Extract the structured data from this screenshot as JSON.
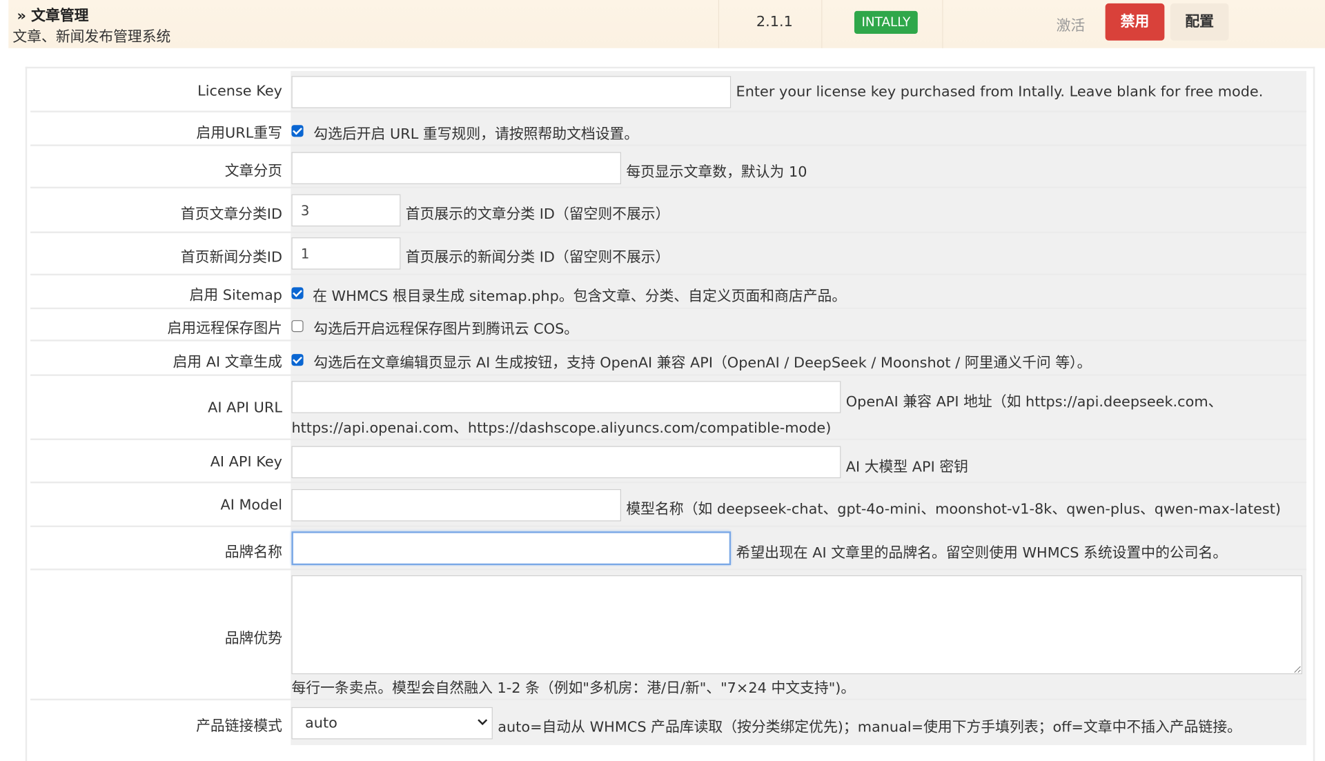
{
  "module": {
    "title": "» 文章管理",
    "subtitle": "文章、新闻发布管理系统",
    "version": "2.1.1",
    "badge": "INTALLY",
    "activate": "激活",
    "disable": "禁用",
    "config": "配置"
  },
  "settings": {
    "license_key": {
      "label": "License Key",
      "value": "",
      "desc": "Enter your license key purchased from Intally. Leave blank for free mode."
    },
    "url_rewrite": {
      "label": "启用URL重写",
      "checked": true,
      "desc": "勾选后开启 URL 重写规则，请按照帮助文档设置。"
    },
    "pagination": {
      "label": "文章分页",
      "value": "",
      "desc": "每页显示文章数，默认为 10"
    },
    "home_article_cat": {
      "label": "首页文章分类ID",
      "value": "3",
      "desc": "首页展示的文章分类 ID（留空则不展示）"
    },
    "home_news_cat": {
      "label": "首页新闻分类ID",
      "value": "1",
      "desc": "首页展示的新闻分类 ID（留空则不展示）"
    },
    "sitemap": {
      "label": "启用 Sitemap",
      "checked": true,
      "desc": "在 WHMCS 根目录生成 sitemap.php。包含文章、分类、自定义页面和商店产品。"
    },
    "remote_images": {
      "label": "启用远程保存图片",
      "checked": false,
      "desc": "勾选后开启远程保存图片到腾讯云 COS。"
    },
    "ai_generate": {
      "label": "启用 AI 文章生成",
      "checked": true,
      "desc": "勾选后在文章编辑页显示 AI 生成按钮，支持 OpenAI 兼容 API（OpenAI / DeepSeek / Moonshot / 阿里通义千问 等）。"
    },
    "ai_api_url": {
      "label": "AI API URL",
      "value": "",
      "desc_line1": "OpenAI 兼容 API 地址（如 https://api.deepseek.com、",
      "desc_line2": "https://api.openai.com、https://dashscope.aliyuncs.com/compatible-mode)"
    },
    "ai_api_key": {
      "label": "AI API Key",
      "value": "",
      "desc": "AI 大模型 API 密钥"
    },
    "ai_model": {
      "label": "AI Model",
      "value": "",
      "desc": "模型名称（如 deepseek-chat、gpt-4o-mini、moonshot-v1-8k、qwen-plus、qwen-max-latest)"
    },
    "brand_name": {
      "label": "品牌名称",
      "value": "",
      "desc": "希望出现在 AI 文章里的品牌名。留空则使用 WHMCS 系统设置中的公司名。"
    },
    "brand_advantages": {
      "label": "品牌优势",
      "value": "",
      "desc": "每行一条卖点。模型会自然融入 1-2 条（例如\"多机房：港/日/新\"、\"7×24 中文支持\")。"
    },
    "product_link_mode": {
      "label": "产品链接模式",
      "selected": "auto",
      "desc": "auto=自动从 WHMCS 产品库读取（按分类绑定优先)；manual=使用下方手填列表；off=文章中不插入产品链接。"
    }
  }
}
